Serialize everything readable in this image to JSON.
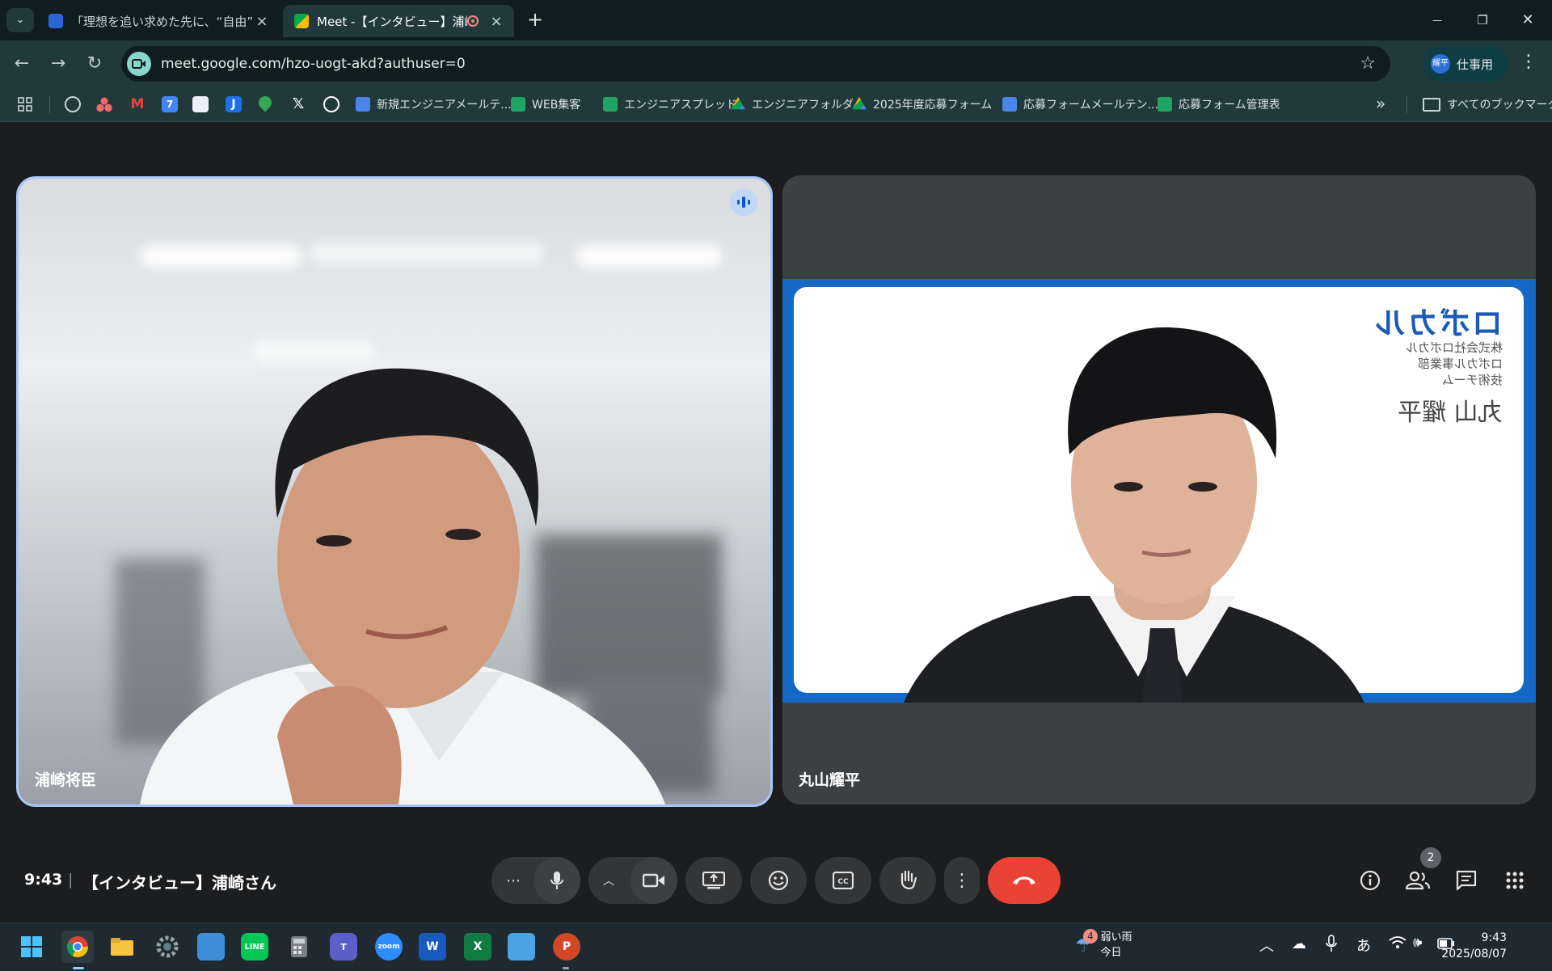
{
  "browser": {
    "tabs": [
      {
        "title": "「理想を追い求めた先に、“自由”と",
        "active": false
      },
      {
        "title": "Meet -【インタビュー】浦崎さん",
        "active": true
      }
    ],
    "new_tab": "+",
    "window": {
      "minimize": "—",
      "restore": "❐",
      "close": "✕"
    },
    "url": "meet.google.com/hzo-uogt-akd?authuser=0",
    "profile": {
      "avatar": "耀平",
      "label": "仕事用"
    },
    "bookmarks": [
      {
        "label": "新規エンジニアメールテ...",
        "icon": "docs-icon",
        "color": "#4a86e8"
      },
      {
        "label": "WEB集客",
        "icon": "sheets-icon",
        "color": "#1fa463"
      },
      {
        "label": "エンジニアスプレッド",
        "icon": "sheets-icon",
        "color": "#1fa463"
      },
      {
        "label": "エンジニアフォルダ",
        "icon": "drive-icon",
        "color": "#f4b400"
      },
      {
        "label": "2025年度応募フォーム",
        "icon": "drive-icon",
        "color": "#f4b400"
      },
      {
        "label": "応募フォームメールテン...",
        "icon": "docs-icon",
        "color": "#4a86e8"
      },
      {
        "label": "応募フォーム管理表",
        "icon": "sheets-icon",
        "color": "#1fa463"
      }
    ],
    "bookmarks_more": "»",
    "all_bookmarks": "すべてのブックマーク"
  },
  "meet": {
    "participants": [
      {
        "name": "浦崎将臣",
        "speaking": true
      },
      {
        "name": "丸山耀平",
        "speaking": false
      }
    ],
    "card": {
      "logo": "ロボカル",
      "lines": [
        "株式会社ロボカル",
        "ロボカル事業部",
        "技術チーム"
      ],
      "name": "丸山 耀平"
    },
    "time": "9:43",
    "separator": "|",
    "meeting_title": "【インタビュー】浦崎さん",
    "people_count": "2",
    "accent_end_call": "#ea4335"
  },
  "taskbar": {
    "weather": {
      "badge": "4",
      "condition": "弱い雨",
      "day": "今日"
    },
    "ime": "あ",
    "time": "9:43",
    "date": "2025/08/07",
    "apps": [
      "start-icon",
      "chrome-icon",
      "explorer-icon",
      "settings-icon",
      "control-panel-icon",
      "line-icon",
      "calculator-icon",
      "teams-icon",
      "zoom-icon",
      "word-icon",
      "excel-icon",
      "notepad-icon",
      "powerpoint-icon"
    ],
    "app_labels": {
      "line": "LINE",
      "zoom": "zoom",
      "word": "W",
      "excel": "X",
      "powerpoint": "P"
    }
  }
}
